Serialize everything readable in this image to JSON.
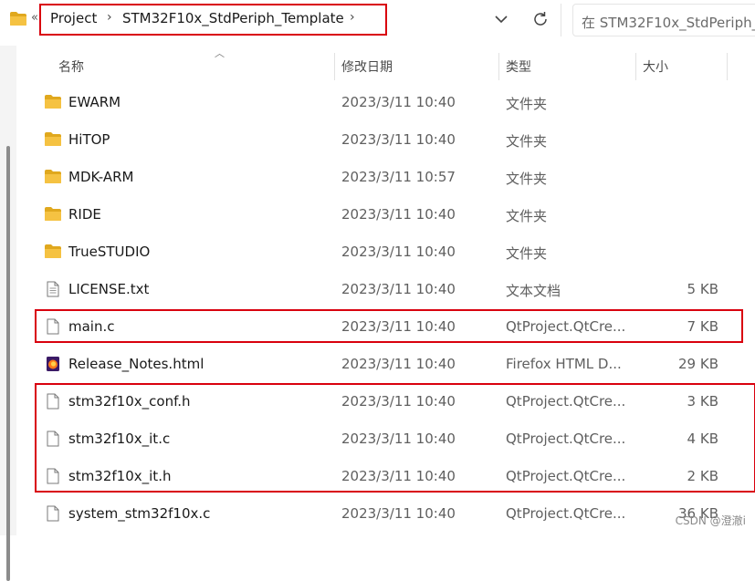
{
  "address_bar": {
    "overflow_glyph": "«",
    "crumbs": [
      "Project",
      "STM32F10x_StdPeriph_Template"
    ],
    "separator": "›"
  },
  "search": {
    "placeholder": "在 STM32F10x_StdPeriph_"
  },
  "columns": {
    "name": "名称",
    "date": "修改日期",
    "type": "类型",
    "size": "大小"
  },
  "files": [
    {
      "name": "EWARM",
      "date": "2023/3/11 10:40",
      "type": "文件夹",
      "size": "",
      "icon": "folder-icon"
    },
    {
      "name": "HiTOP",
      "date": "2023/3/11 10:40",
      "type": "文件夹",
      "size": "",
      "icon": "folder-icon"
    },
    {
      "name": "MDK-ARM",
      "date": "2023/3/11 10:57",
      "type": "文件夹",
      "size": "",
      "icon": "folder-icon"
    },
    {
      "name": "RIDE",
      "date": "2023/3/11 10:40",
      "type": "文件夹",
      "size": "",
      "icon": "folder-icon"
    },
    {
      "name": "TrueSTUDIO",
      "date": "2023/3/11 10:40",
      "type": "文件夹",
      "size": "",
      "icon": "folder-icon"
    },
    {
      "name": "LICENSE.txt",
      "date": "2023/3/11 10:40",
      "type": "文本文档",
      "size": "5 KB",
      "icon": "text-file-icon"
    },
    {
      "name": "main.c",
      "date": "2023/3/11 10:40",
      "type": "QtProject.QtCre...",
      "size": "7 KB",
      "icon": "file-icon"
    },
    {
      "name": "Release_Notes.html",
      "date": "2023/3/11 10:40",
      "type": "Firefox HTML D...",
      "size": "29 KB",
      "icon": "firefox-html-icon"
    },
    {
      "name": "stm32f10x_conf.h",
      "date": "2023/3/11 10:40",
      "type": "QtProject.QtCre...",
      "size": "3 KB",
      "icon": "file-icon"
    },
    {
      "name": "stm32f10x_it.c",
      "date": "2023/3/11 10:40",
      "type": "QtProject.QtCre...",
      "size": "4 KB",
      "icon": "file-icon"
    },
    {
      "name": "stm32f10x_it.h",
      "date": "2023/3/11 10:40",
      "type": "QtProject.QtCre...",
      "size": "2 KB",
      "icon": "file-icon"
    },
    {
      "name": "system_stm32f10x.c",
      "date": "2023/3/11 10:40",
      "type": "QtProject.QtCre...",
      "size": "36 KB",
      "icon": "file-icon"
    }
  ],
  "watermark": "CSDN @澄澈i",
  "colors": {
    "highlight": "#d9000e",
    "folder": "#f5c242",
    "folder_dark": "#e0a81e"
  }
}
